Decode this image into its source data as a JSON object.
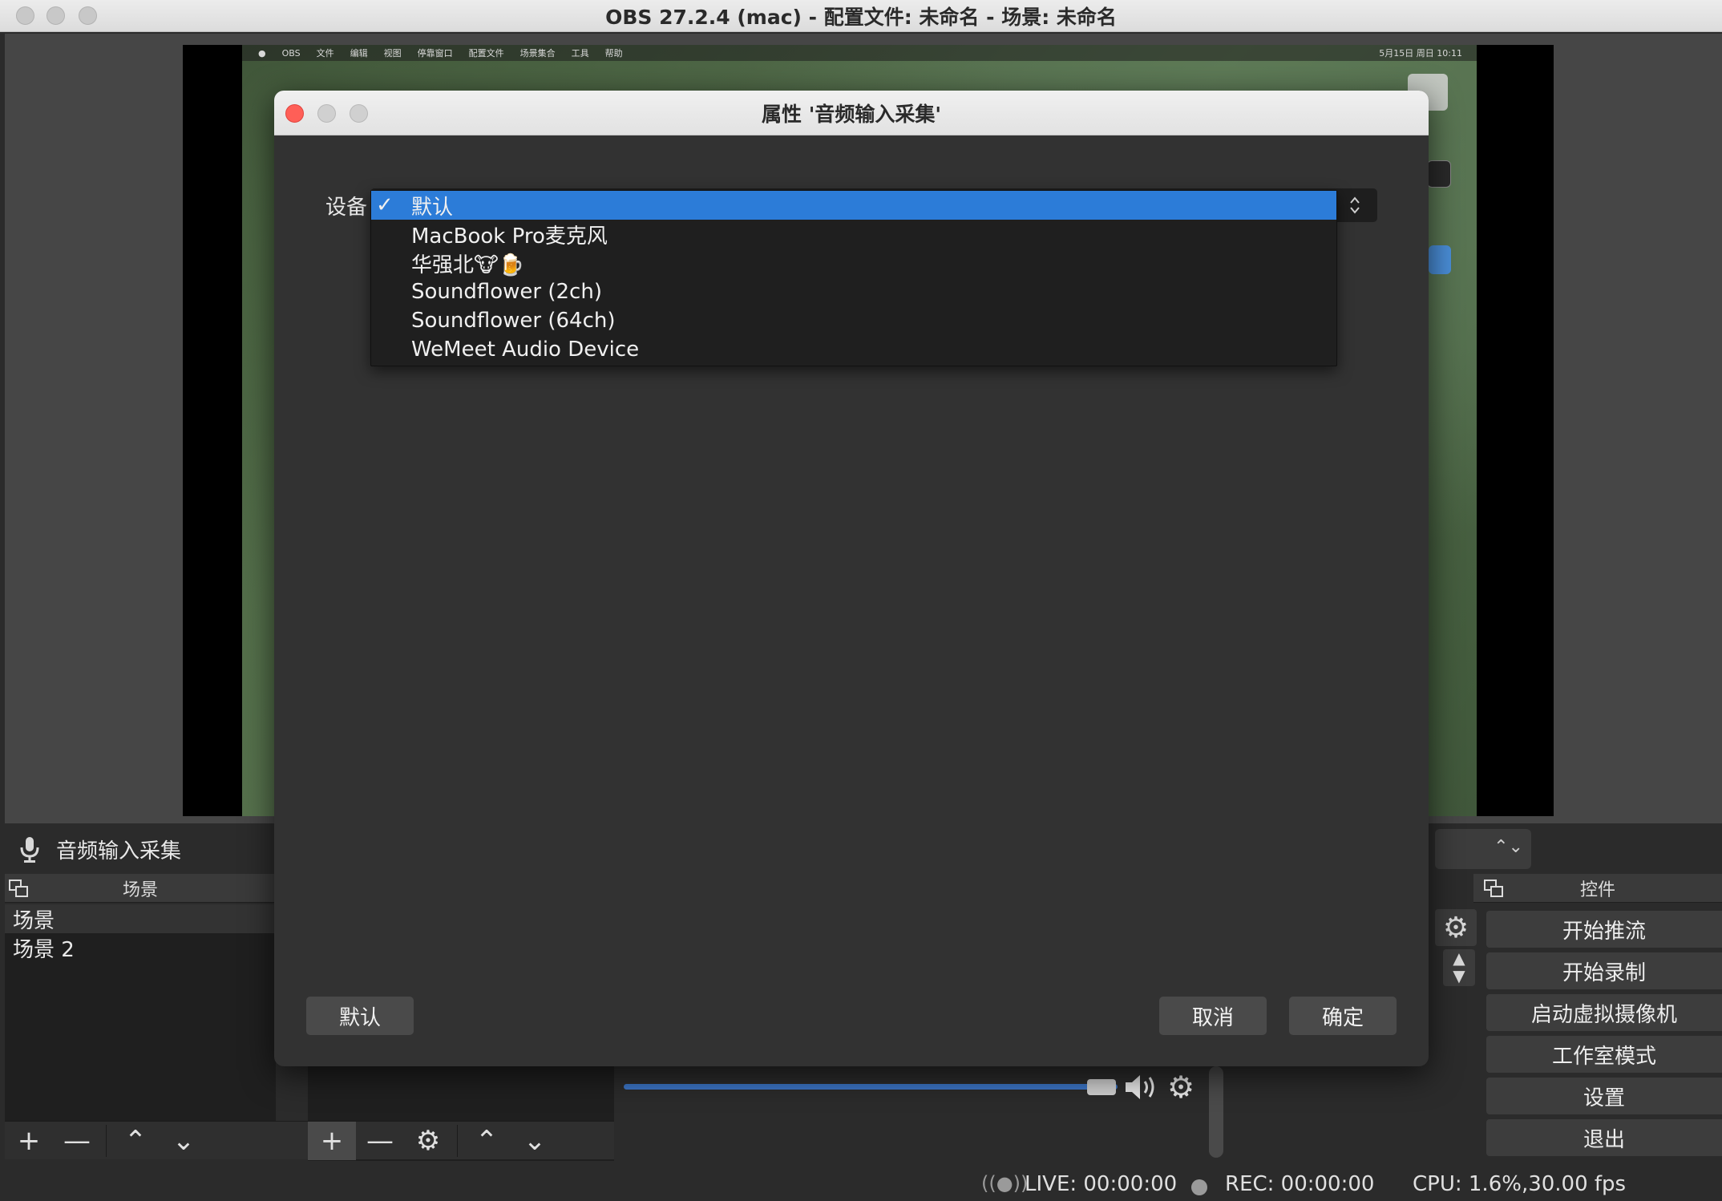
{
  "window": {
    "title": "OBS 27.2.4 (mac) - 配置文件: 未命名 - 场景: 未命名"
  },
  "preview_menubar": {
    "items": [
      "OBS",
      "文件",
      "编辑",
      "视图",
      "停靠窗口",
      "配置文件",
      "场景集合",
      "工具",
      "帮助"
    ],
    "status": "5月15日 周日 10:11"
  },
  "source_header": {
    "icon": "microphone-icon",
    "label": "音频输入采集"
  },
  "scenes": {
    "title": "场景",
    "items": [
      "场景",
      "场景 2"
    ]
  },
  "scene_toolbar": {
    "add": "+",
    "remove": "—",
    "up": "⌃",
    "down": "⌄"
  },
  "source_toolbar": {
    "add": "+",
    "remove": "—",
    "settings": "⚙",
    "up": "⌃",
    "down": "⌄"
  },
  "controls": {
    "title": "控件",
    "buttons": [
      "开始推流",
      "开始录制",
      "启动虚拟摄像机",
      "工作室模式",
      "设置",
      "退出"
    ]
  },
  "status_bar": {
    "live": "LIVE: 00:00:00",
    "rec": "REC: 00:00:00",
    "cpu": "CPU: 1.6%,30.00 fps"
  },
  "dialog": {
    "title": "属性 '音频输入采集'",
    "device_label": "设备",
    "options": [
      "默认",
      "MacBook Pro麦克风",
      "华强北🐮🍺",
      "Soundflower (2ch)",
      "Soundflower (64ch)",
      "WeMeet Audio Device"
    ],
    "selected_index": 0,
    "check_mark": "✓",
    "defaults_button": "默认",
    "cancel_button": "取消",
    "ok_button": "确定"
  },
  "colors": {
    "accent": "#2c7cd8",
    "close": "#ff5f57",
    "volume": "#3b74c4"
  }
}
